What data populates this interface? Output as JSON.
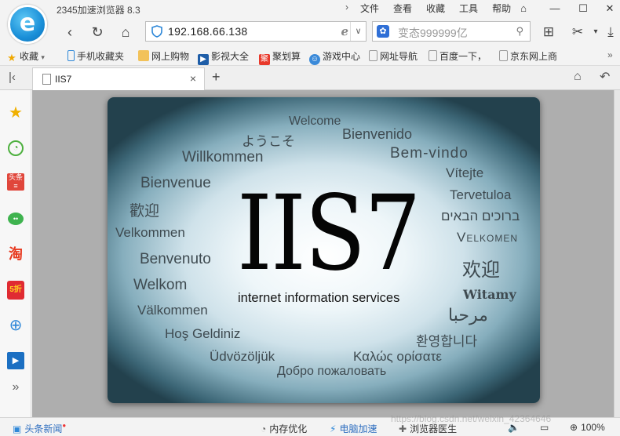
{
  "app": {
    "title": "2345加速浏览器 8.3",
    "logo_letter": "e"
  },
  "menu": [
    "文件",
    "查看",
    "收藏",
    "工具",
    "帮助"
  ],
  "address": {
    "url": "192.168.66.138",
    "search_placeholder": "变态999999亿"
  },
  "bookmarks": {
    "favorites_label": "收藏",
    "items": [
      "手机收藏夹",
      "网上购物",
      "影视大全",
      "聚划算",
      "游戏中心",
      "网址导航",
      "百度一下，",
      "京东网上商"
    ]
  },
  "tab": {
    "title": "IIS7",
    "close": "×",
    "new_tab": "+"
  },
  "splash": {
    "logo": "IIS7",
    "subtitle": "internet information services",
    "welcome_words": [
      "Welcome",
      "ようこそ",
      "Bienvenido",
      "Bem-vindo",
      "Willkommen",
      "Vítejte",
      "Bienvenue",
      "Tervetuloa",
      "歡迎",
      "ברוכים הבאים",
      "Velkommen",
      "Velkomen",
      "Benvenuto",
      "欢迎",
      "Welkom",
      "Witamy",
      "Välkommen",
      "مرحبا",
      "Hoş Geldiniz",
      "환영합니다",
      "Üdvözöljük",
      "Καλώς ορίσατε",
      "Добро пожаловать"
    ]
  },
  "statusbar": {
    "news": "头条新闻",
    "memory": "内存优化",
    "accelerate": "电脑加速",
    "doctor": "浏览器医生",
    "zoom": "100%",
    "watermark": "https://blog.csdn.net/weixin_42364646"
  },
  "colors": {
    "accent_blue": "#1a8fd8",
    "content_bg": "#aeaeae"
  }
}
